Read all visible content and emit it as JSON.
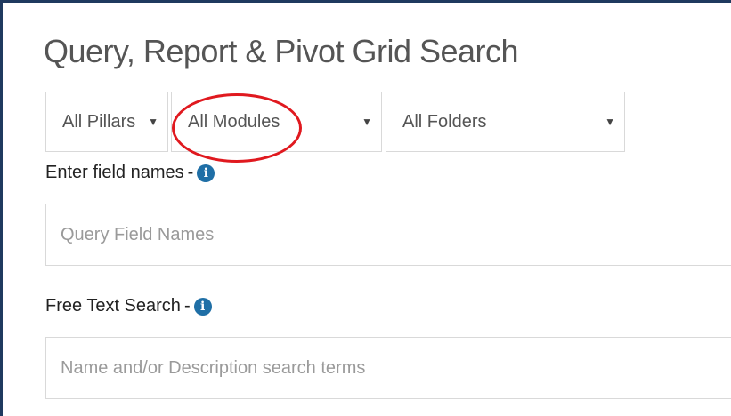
{
  "page": {
    "title": "Query, Report & Pivot Grid Search"
  },
  "filters": {
    "pillars": {
      "value": "All Pillars",
      "caret": "▼"
    },
    "modules": {
      "value": "All Modules",
      "caret": "▼"
    },
    "folders": {
      "value": "All Folders",
      "caret": "▼"
    }
  },
  "fields_section": {
    "label": "Enter field names",
    "dash": "-",
    "info_glyph": "i",
    "placeholder": "Query Field Names"
  },
  "free_text_section": {
    "label": "Free Text Search",
    "dash": "-",
    "info_glyph": "i",
    "placeholder": "Name and/or Description search terms"
  },
  "colors": {
    "highlight_oval": "#e0191f",
    "info_icon": "#1f6fa6",
    "frame_border": "#1f3a5f"
  }
}
